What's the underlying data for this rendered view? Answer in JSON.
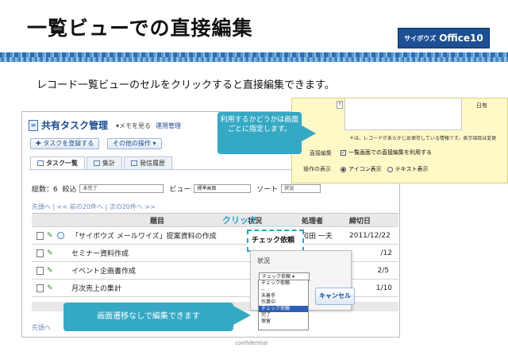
{
  "slide": {
    "title": "一覧ビューでの直接編集",
    "brand_small": "サイボウズ",
    "brand_main": "Office10",
    "lead": "レコード一覧ビューのセルをクリックすると直接編集できます。",
    "confidential": "confidential"
  },
  "app": {
    "title": "共有タスク管理",
    "memo_link": "▾メモを見る",
    "admin_link": "運用管理",
    "add_button": "タスクを登録する",
    "ops_button": "その他の操作 ▾",
    "tabs": [
      "タスク一覧",
      "集計",
      "発信履歴"
    ],
    "filters": {
      "total": "総数：6",
      "narrow_label": "絞込",
      "narrow_value": "未完了",
      "view_label": "ビュー",
      "view_value": "標準画面",
      "sort_label": "ソート",
      "sort_value": "状況"
    },
    "pager": "先頭へ | << 前の20件へ | 次の20件へ >>",
    "pager_bottom": "先頭へ",
    "columns": [
      "題目",
      "状況",
      "処理者",
      "締切日"
    ],
    "rows": [
      {
        "title": "「サイボウズ メールワイズ」提案資料の作成",
        "status": "チェック依頼",
        "owner": "和田 一夫",
        "due": "2011/12/22"
      },
      {
        "title": "セミナー資料作成",
        "status": "",
        "owner": "",
        "due": "/12"
      },
      {
        "title": "イベント企画書作成",
        "status": "",
        "owner": "",
        "due": "2/5"
      },
      {
        "title": "月次売上の集計",
        "status": "",
        "owner": "",
        "due": "1/10"
      }
    ],
    "click_label": "クリック",
    "popup": {
      "title": "状況",
      "selected": "チェック依頼",
      "cancel": "キャンセル",
      "options": [
        "チェック依頼",
        "--",
        "未着手",
        "作業中",
        "チェック依頼",
        "完了",
        "保留"
      ]
    }
  },
  "settings_inset": {
    "scroll_glyph": "⇡",
    "truncated": "日有",
    "note": "＊は、レコードがあらかじめ保存している情報です。表示項目は変更",
    "direct_edit_label": "直接編集",
    "direct_edit_option": "一覧画面での直接編集を利用する",
    "display_label": "操作の表示",
    "radio_icon": "アイコン表示",
    "radio_text": "テキスト表示"
  },
  "callouts": {
    "top": "利用するかどうかは画面ごとに指定します。",
    "bottom": "画面遷移なしで編集できます"
  },
  "colors": {
    "accent": "#35a8c4",
    "brand": "#1d4f94",
    "inset_bg": "#fff9c8"
  }
}
